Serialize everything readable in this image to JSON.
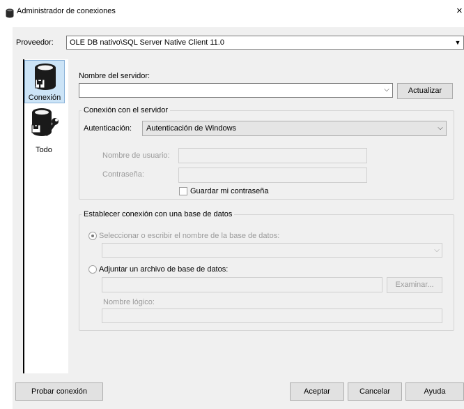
{
  "window": {
    "title": "Administrador de conexiones",
    "close_glyph": "×"
  },
  "provider": {
    "label": "Proveedor:",
    "value": "OLE DB nativo\\SQL Server Native Client 11.0"
  },
  "nav": [
    {
      "label": "Conexión",
      "icon": "database-plug-icon"
    },
    {
      "label": "Todo",
      "icon": "database-tools-icon"
    }
  ],
  "server": {
    "label": "Nombre del servidor:",
    "value": "",
    "refresh_button": "Actualizar"
  },
  "connection_group": {
    "title": "Conexión con el servidor",
    "auth_label": "Autenticación:",
    "auth_value": "Autenticación de Windows",
    "user_label": "Nombre de usuario:",
    "password_label": "Contraseña:",
    "save_password_label": "Guardar mi contraseña"
  },
  "database_group": {
    "title": "Establecer conexión con una base de datos",
    "select_option_label": "Seleccionar o escribir el nombre de la base de datos:",
    "attach_option_label": "Adjuntar un archivo de base de datos:",
    "browse_button": "Examinar...",
    "logical_name_label": "Nombre lógico:"
  },
  "footer": {
    "test_button": "Probar conexión",
    "accept_button": "Aceptar",
    "cancel_button": "Cancelar",
    "help_button": "Ayuda"
  }
}
